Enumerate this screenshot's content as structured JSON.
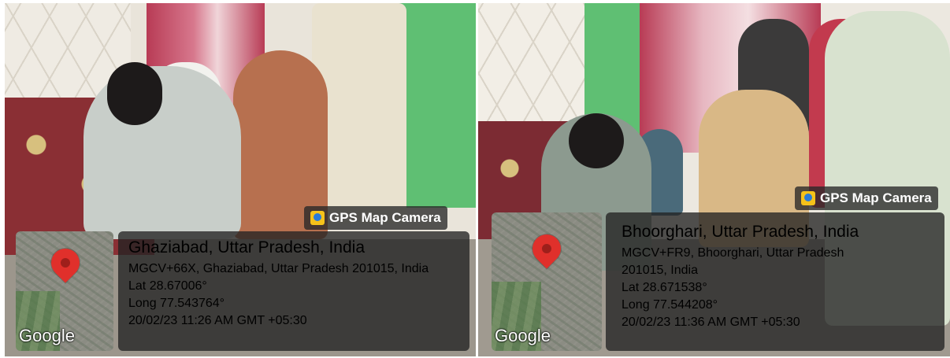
{
  "photos": [
    {
      "badge": {
        "icon": "gps-map-camera-icon",
        "label": "GPS Map Camera"
      },
      "map": {
        "logo": "Google",
        "icon": "map-pin-icon"
      },
      "location": {
        "title": "Ghaziabad, Uttar Pradesh, India",
        "address_lines": [
          "MGCV+66X, Ghaziabad, Uttar Pradesh 201015, India"
        ],
        "lat": "Lat 28.67006°",
        "long": "Long 77.543764°",
        "datetime": "20/02/23 11:26 AM GMT +05:30"
      }
    },
    {
      "badge": {
        "icon": "gps-map-camera-icon",
        "label": "GPS Map Camera"
      },
      "map": {
        "logo": "Google",
        "icon": "map-pin-icon"
      },
      "location": {
        "title": "Bhoorghari, Uttar Pradesh, India",
        "address_lines": [
          "MGCV+FR9, Bhoorghari, Uttar Pradesh",
          "201015, India"
        ],
        "lat": "Lat 28.671538°",
        "long": "Long 77.544208°",
        "datetime": "20/02/23 11:36 AM GMT +05:30"
      }
    }
  ]
}
